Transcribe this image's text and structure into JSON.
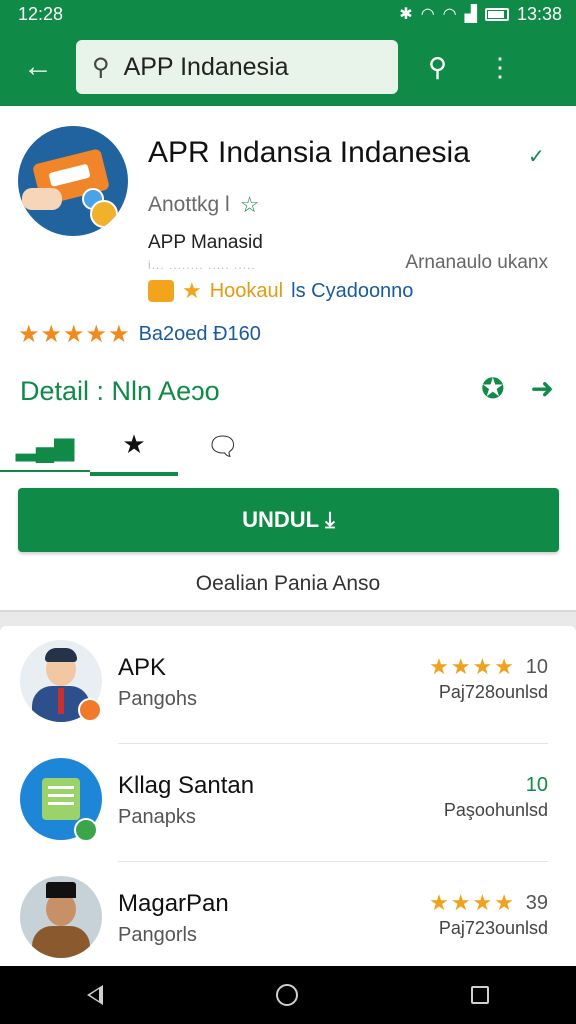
{
  "status": {
    "time_left": "12:28",
    "time_right": "13:38"
  },
  "search": {
    "query": "APP Indanesia"
  },
  "app": {
    "title": "APR Indansia Indanesia",
    "rating_text": "Anottkg l",
    "developer": "APP Manasid",
    "faint_text": "i... ........ ..... .....",
    "side_note": "Arnanaulo ukanx",
    "promo_highlight": "Hookaul",
    "promo_rest": "ls Cyadoonno",
    "stars": "★★★★★",
    "reviews": "Ba2oed Đ160"
  },
  "details": {
    "label": "Detail : Nln Aeɔo"
  },
  "tabs": [
    "chart",
    "star",
    "message"
  ],
  "install": {
    "label": "UNDUL"
  },
  "install_note": "Oealian Pania Anso",
  "related": [
    {
      "name": "APK",
      "category": "Pangohs",
      "stars": "★★★★",
      "rating": "10",
      "sub": "Paj728ounlsd"
    },
    {
      "name": "Kllag Santan",
      "category": "Panapks",
      "stars": "",
      "rating": "10",
      "sub": "Paşoohunlsd"
    },
    {
      "name": "MagarPan",
      "category": "Pangorls",
      "stars": "★★★★",
      "rating": "39",
      "sub": "Paj723ounlsd"
    }
  ],
  "colors": {
    "primary": "#0f8a47",
    "star": "#f08a1e",
    "link": "#1a5aa0"
  }
}
